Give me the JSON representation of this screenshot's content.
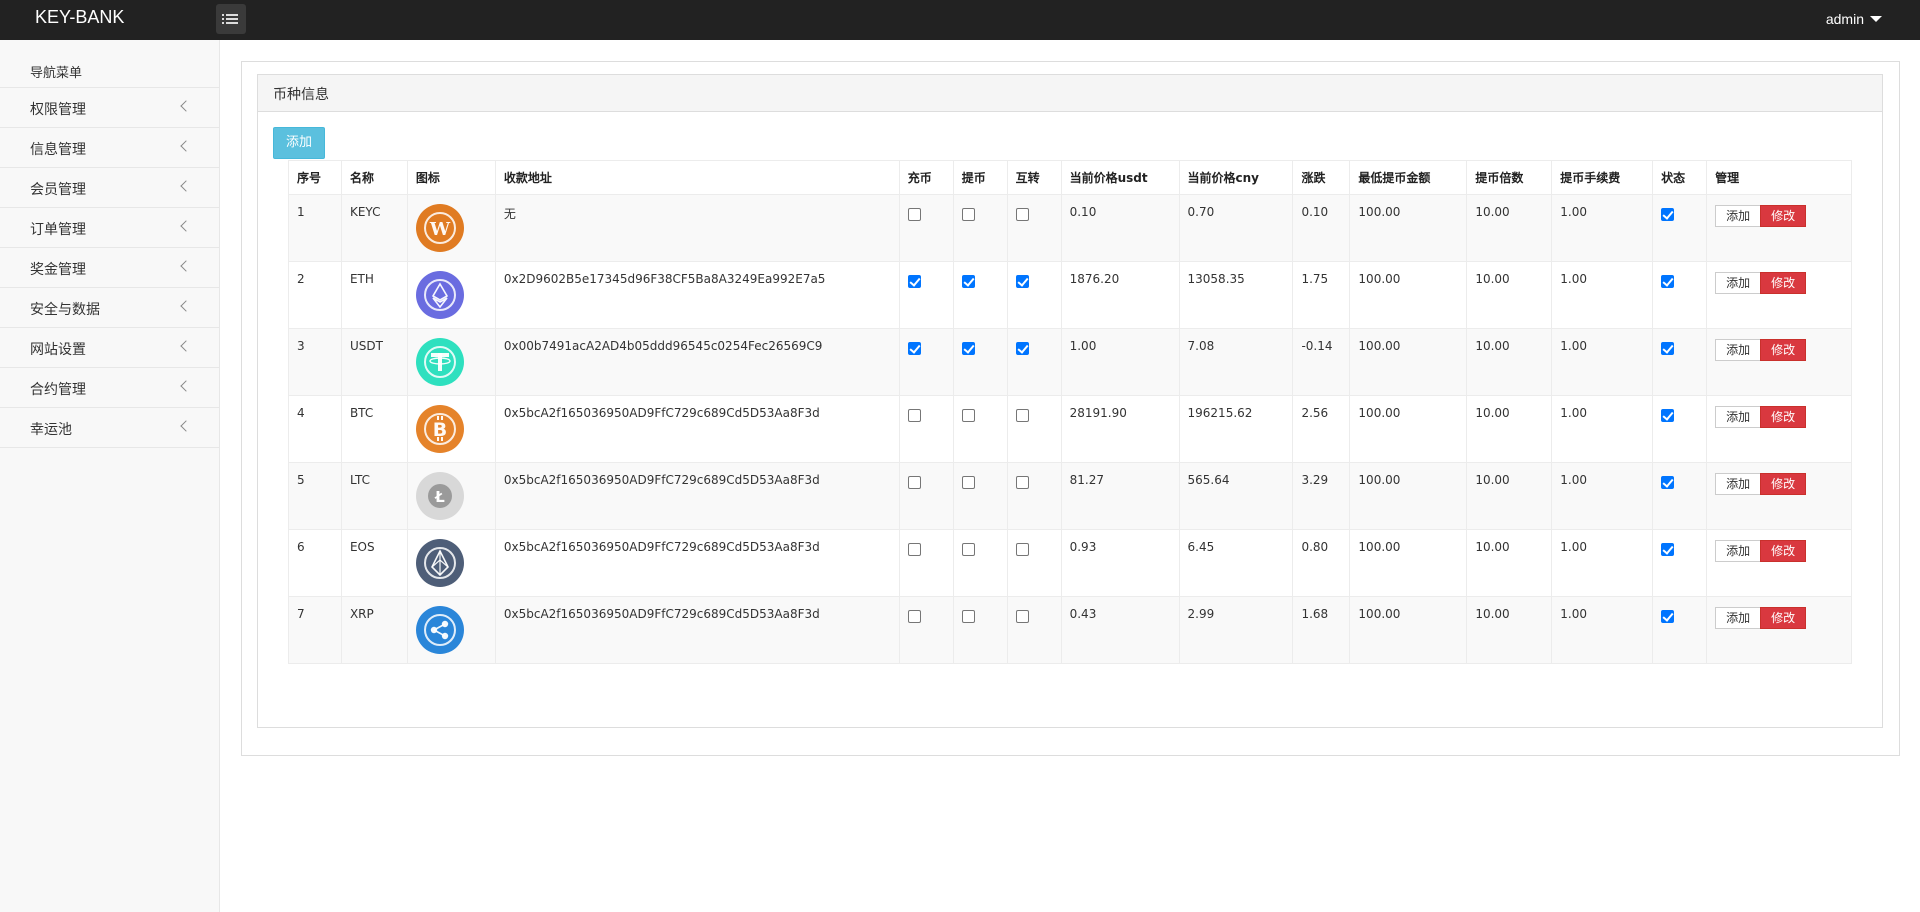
{
  "header": {
    "brand": "KEY-BANK",
    "user": "admin"
  },
  "sidebar": {
    "title": "导航菜单",
    "items": [
      {
        "label": "权限管理"
      },
      {
        "label": "信息管理"
      },
      {
        "label": "会员管理"
      },
      {
        "label": "订单管理"
      },
      {
        "label": "奖金管理"
      },
      {
        "label": "安全与数据"
      },
      {
        "label": "网站设置"
      },
      {
        "label": "合约管理"
      },
      {
        "label": "幸运池"
      }
    ]
  },
  "panel": {
    "title": "币种信息",
    "add_label": "添加"
  },
  "table": {
    "columns": [
      "序号",
      "名称",
      "图标",
      "收款地址",
      "充币",
      "提币",
      "互转",
      "当前价格usdt",
      "当前价格cny",
      "涨跌",
      "最低提币金额",
      "提币倍数",
      "提币手续费",
      "状态",
      "管理"
    ],
    "action_add": "添加",
    "action_edit": "修改",
    "rows": [
      {
        "id": "1",
        "name": "KEYC",
        "icon": "keyc-coin-icon",
        "color": "#e07b22",
        "address": "无",
        "deposit": false,
        "withdraw": false,
        "transfer": false,
        "usdt": "0.10",
        "cny": "0.70",
        "change": "0.10",
        "min": "100.00",
        "mult": "10.00",
        "fee": "1.00",
        "status": true
      },
      {
        "id": "2",
        "name": "ETH",
        "icon": "eth-coin-icon",
        "color": "#6a6ce0",
        "address": "0x2D9602B5e17345d96F38CF5Ba8A3249Ea992E7a5",
        "deposit": true,
        "withdraw": true,
        "transfer": true,
        "usdt": "1876.20",
        "cny": "13058.35",
        "change": "1.75",
        "min": "100.00",
        "mult": "10.00",
        "fee": "1.00",
        "status": true
      },
      {
        "id": "3",
        "name": "USDT",
        "icon": "usdt-coin-icon",
        "color": "#2ee0bf",
        "address": "0x00b7491acA2AD4b05ddd96545c0254Fec26569C9",
        "deposit": true,
        "withdraw": true,
        "transfer": true,
        "usdt": "1.00",
        "cny": "7.08",
        "change": "-0.14",
        "min": "100.00",
        "mult": "10.00",
        "fee": "1.00",
        "status": true
      },
      {
        "id": "4",
        "name": "BTC",
        "icon": "btc-coin-icon",
        "color": "#e5832a",
        "address": "0x5bcA2f165036950AD9FfC729c689Cd5D53Aa8F3d",
        "deposit": false,
        "withdraw": false,
        "transfer": false,
        "usdt": "28191.90",
        "cny": "196215.62",
        "change": "2.56",
        "min": "100.00",
        "mult": "10.00",
        "fee": "1.00",
        "status": true
      },
      {
        "id": "5",
        "name": "LTC",
        "icon": "ltc-coin-icon",
        "color": "#d8d8d8",
        "address": "0x5bcA2f165036950AD9FfC729c689Cd5D53Aa8F3d",
        "deposit": false,
        "withdraw": false,
        "transfer": false,
        "usdt": "81.27",
        "cny": "565.64",
        "change": "3.29",
        "min": "100.00",
        "mult": "10.00",
        "fee": "1.00",
        "status": true
      },
      {
        "id": "6",
        "name": "EOS",
        "icon": "eos-coin-icon",
        "color": "#4e5e78",
        "address": "0x5bcA2f165036950AD9FfC729c689Cd5D53Aa8F3d",
        "deposit": false,
        "withdraw": false,
        "transfer": false,
        "usdt": "0.93",
        "cny": "6.45",
        "change": "0.80",
        "min": "100.00",
        "mult": "10.00",
        "fee": "1.00",
        "status": true
      },
      {
        "id": "7",
        "name": "XRP",
        "icon": "xrp-coin-icon",
        "color": "#2a86d9",
        "address": "0x5bcA2f165036950AD9FfC729c689Cd5D53Aa8F3d",
        "deposit": false,
        "withdraw": false,
        "transfer": false,
        "usdt": "0.43",
        "cny": "2.99",
        "change": "1.68",
        "min": "100.00",
        "mult": "10.00",
        "fee": "1.00",
        "status": true
      }
    ]
  }
}
